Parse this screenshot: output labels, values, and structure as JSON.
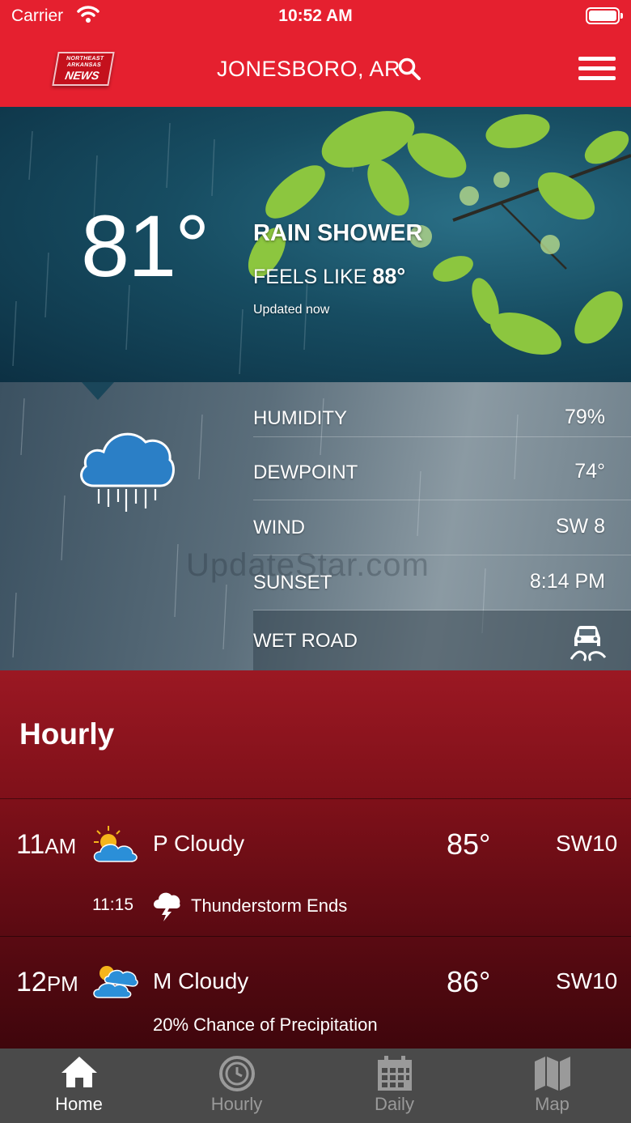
{
  "status_bar": {
    "carrier": "Carrier",
    "time": "10:52 AM"
  },
  "header": {
    "logo": {
      "line1": "NORTHEAST ARKANSAS",
      "line2": "NEWS"
    },
    "location": "JONESBORO, AR",
    "brand_color": "#e5202f"
  },
  "current": {
    "temperature": "81°",
    "condition": "RAIN SHOWER",
    "feels_like_label": "FEELS LIKE",
    "feels_like_value": "88°",
    "updated": "Updated now",
    "icon": "rain-cloud-icon"
  },
  "details": [
    {
      "label": "HUMIDITY",
      "value": "79%"
    },
    {
      "label": "DEWPOINT",
      "value": "74°"
    },
    {
      "label": "WIND",
      "value": "SW 8"
    },
    {
      "label": "SUNSET",
      "value": "8:14 PM"
    },
    {
      "label": "WET ROAD",
      "icon": "slippery-road-icon"
    }
  ],
  "watermark": "UpdateStar.com",
  "hourly": {
    "title": "Hourly",
    "items": [
      {
        "hour": "11",
        "ampm": "AM",
        "icon": "partly-cloudy-icon",
        "condition": "P Cloudy",
        "temp": "85°",
        "wind": "SW10",
        "alert_time": "11:15",
        "alert_icon": "thunderstorm-icon",
        "alert_text": "Thunderstorm Ends"
      },
      {
        "hour": "12",
        "ampm": "PM",
        "icon": "mostly-cloudy-icon",
        "condition": "M Cloudy",
        "temp": "86°",
        "wind": "SW10",
        "precip": "20% Chance of Precipitation"
      }
    ]
  },
  "tabs": [
    {
      "label": "Home",
      "icon": "home-icon",
      "active": true
    },
    {
      "label": "Hourly",
      "icon": "clock-icon",
      "active": false
    },
    {
      "label": "Daily",
      "icon": "calendar-icon",
      "active": false
    },
    {
      "label": "Map",
      "icon": "map-icon",
      "active": false
    }
  ]
}
